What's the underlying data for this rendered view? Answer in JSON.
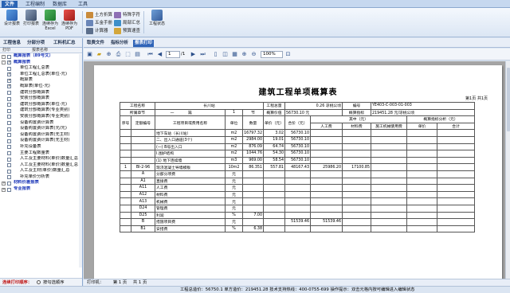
{
  "ribbon_tabs": [
    "文件",
    "工程编制",
    "数据库",
    "工具"
  ],
  "ribbon": {
    "large_buttons": [
      {
        "label1": "设计报表",
        "label2": "",
        "icon": "design-report-icon"
      },
      {
        "label1": "打印报表",
        "label2": "",
        "icon": "print-report-icon"
      },
      {
        "label1": "连续存为",
        "label2": "Excel",
        "icon": "excel-icon"
      },
      {
        "label1": "连续存为",
        "label2": "PDF",
        "icon": "pdf-icon"
      }
    ],
    "small_buttons": [
      "土方折算",
      "五金手册",
      "计算器",
      "特殊字符",
      "局部汇总",
      "预算速查"
    ],
    "tool_status": "工程状态"
  },
  "left_tabs": [
    "工程信息",
    "分部分项",
    "工料机汇总"
  ],
  "left_header": {
    "print": "打印",
    "name": "报表名称"
  },
  "tree": [
    {
      "text": "概算报表（89号文）",
      "level": 0,
      "blue": true,
      "checked": false,
      "expand": "-"
    },
    {
      "text": "概算报表",
      "level": 0,
      "blue": true,
      "checked": true,
      "expand": "-"
    },
    {
      "text": "单位工程汇总表",
      "level": 1,
      "blue": false,
      "checked": false
    },
    {
      "text": "单位工程汇总表(单位-元)",
      "level": 1,
      "blue": false,
      "checked": true
    },
    {
      "text": "概算表",
      "level": 1,
      "blue": false,
      "checked": true
    },
    {
      "text": "概算表(单位-元)",
      "level": 1,
      "blue": false,
      "checked": true
    },
    {
      "text": "建筑分部概算表",
      "level": 1,
      "blue": false,
      "checked": false
    },
    {
      "text": "安装分部概算表",
      "level": 1,
      "blue": false,
      "checked": false
    },
    {
      "text": "建筑分部概算表(单位-元)",
      "level": 1,
      "blue": false,
      "checked": false
    },
    {
      "text": "建筑分部概算表(专业类别)",
      "level": 1,
      "blue": false,
      "checked": false
    },
    {
      "text": "安装分部概算表(专业类别)",
      "level": 1,
      "blue": false,
      "checked": false
    },
    {
      "text": "设备购置费计算表",
      "level": 1,
      "blue": false,
      "checked": false
    },
    {
      "text": "设备购置费计算表(元/元)",
      "level": 1,
      "blue": false,
      "checked": false
    },
    {
      "text": "设备购置费计算表(无主材)",
      "level": 1,
      "blue": false,
      "checked": false
    },
    {
      "text": "设备购置费计算表(无主材)",
      "level": 1,
      "blue": false,
      "checked": false
    },
    {
      "text": "补充设备表",
      "level": 1,
      "blue": false,
      "checked": false
    },
    {
      "text": "主要工程数量表",
      "level": 1,
      "blue": false,
      "checked": false
    },
    {
      "text": "人工及主要材料(单价)数量汇总",
      "level": 1,
      "blue": false,
      "checked": false
    },
    {
      "text": "人工及主要材料(单价)数量汇总",
      "level": 1,
      "blue": false,
      "checked": false
    },
    {
      "text": "人工及主材(单价)数量汇总",
      "level": 1,
      "blue": false,
      "checked": false
    },
    {
      "text": "补充单价分析表",
      "level": 1,
      "blue": false,
      "checked": false
    },
    {
      "text": "材料价差报表",
      "level": 0,
      "blue": true,
      "checked": false,
      "expand": "+"
    },
    {
      "text": "专业报表",
      "level": 0,
      "blue": true,
      "checked": false,
      "expand": "+"
    }
  ],
  "left_footer": {
    "label": "连续打印顺序：",
    "option": "按勾选顺序"
  },
  "right_tabs": [
    "取费文件",
    "指标分析",
    "报表打印"
  ],
  "toolbar": {
    "page_value": "1",
    "page_total": "/1",
    "zoom": "100%"
  },
  "paper": {
    "title": "建筑工程单项概算表",
    "page_info": "第1页 共1页",
    "info1": {
      "k1": "工程名称",
      "v1": "长川站",
      "k2": "工程总量",
      "v2": "0.26 凉桃公顷",
      "k3": "编号",
      "v3": "YE403-C-003-01-003"
    },
    "info2": {
      "k1": "所属章节",
      "v1a": "一",
      "v1b": "篇",
      "v1c": "1",
      "v1d": "节",
      "k2": "概算价值",
      "v2": "56730.10 元",
      "k3": "概算指标",
      "v3": "219451.28 元/凉桃公顷"
    },
    "head1": [
      "序号",
      "定额编号",
      "工程项目或费用名称",
      "单位",
      "数量",
      "单价（元）",
      "合价（元）",
      "其中（元）",
      "概算指标分析（元）"
    ],
    "head2": [
      "人工费",
      "材料费",
      "施工机械使用费",
      "单价",
      "合计"
    ],
    "rows": [
      [
        "",
        "",
        "地下车站（长川站）",
        "m2",
        "16797.32",
        "3.02",
        "56730.10",
        "",
        "",
        "",
        "",
        ""
      ],
      [
        "",
        "",
        "二、出入口通道(3个)",
        "m2",
        "2984.00",
        "19.01",
        "56730.10",
        "",
        "",
        "",
        "",
        ""
      ],
      [
        "",
        "",
        "(一) B号出入口",
        "m2",
        "876.09",
        "64.74",
        "56730.10",
        "",
        "",
        "",
        "",
        ""
      ],
      [
        "",
        "",
        "I.围护结构",
        "m2",
        "1044.76",
        "54.30",
        "56730.10",
        "",
        "",
        "",
        "",
        ""
      ],
      [
        "",
        "",
        "(1) 地下连续墙",
        "m3",
        "969.00",
        "58.54",
        "56730.10",
        "",
        "",
        "",
        "",
        ""
      ],
      [
        "1",
        "BI-2-96",
        "现浇混凝土导墙模板",
        "10m2",
        "86.351",
        "557.81",
        "48167.43",
        "25986.20",
        "17100.85",
        "",
        "",
        ""
      ],
      [
        "",
        "A",
        "分部分项费",
        "元",
        "",
        "",
        "",
        "",
        "",
        "",
        "",
        ""
      ],
      [
        "",
        "A1",
        "直接费",
        "元",
        "",
        "",
        "",
        "",
        "",
        "",
        "",
        ""
      ],
      [
        "",
        "A11",
        "人工费",
        "元",
        "",
        "",
        "",
        "",
        "",
        "",
        "",
        ""
      ],
      [
        "",
        "A12",
        "材料费",
        "元",
        "",
        "",
        "",
        "",
        "",
        "",
        "",
        ""
      ],
      [
        "",
        "A13",
        "机械费",
        "元",
        "",
        "",
        "",
        "",
        "",
        "",
        "",
        ""
      ],
      [
        "",
        "D24",
        "管理费",
        "元",
        "",
        "",
        "",
        "",
        "",
        "",
        "",
        ""
      ],
      [
        "",
        "D25",
        "利润",
        "%",
        "7.00",
        "",
        "",
        "",
        "",
        "",
        "",
        ""
      ],
      [
        "",
        "B",
        "措施项目费",
        "元",
        "",
        "",
        "51539.46",
        "51539.46",
        "",
        "",
        "",
        ""
      ],
      [
        "",
        "B1",
        "安措费",
        "%",
        "6.38",
        "",
        "",
        "",
        "",
        "",
        "",
        ""
      ]
    ]
  },
  "status": {
    "printer": "打印机：",
    "page": "第 1 页",
    "total": "共 1 页"
  },
  "bottom_bar": "工程总造价：56750.1  单方造价：219451.28  技术支持热线：400-0755-699  操作提示：双击元格内按可编辑进入编辑状态"
}
